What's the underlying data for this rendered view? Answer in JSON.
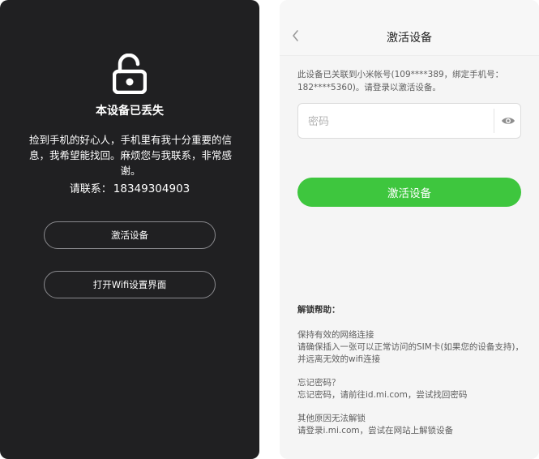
{
  "left": {
    "title": "本设备已丢失",
    "message": "捡到手机的好心人，手机里有我十分重要的信息，我希望能找回。麻烦您与我联系，非常感谢。",
    "contact_label": "请联系：",
    "contact_phone": "18349304903",
    "activate_label": "激活设备",
    "wifi_label": "打开Wifi设置界面"
  },
  "right": {
    "title": "激活设备",
    "device_info": "此设备已关联到小米帐号(109****389，绑定手机号：182****5360)。请登录以激活设备。",
    "password_placeholder": "密码",
    "activate_label": "激活设备",
    "help": {
      "title": "解锁帮助：",
      "sections": [
        {
          "heading": "保持有效的网络连接",
          "body": "请确保插入一张可以正常访问的SIM卡(如果您的设备支持)，并远离无效的wifi连接"
        },
        {
          "heading": "忘记密码？",
          "body": "忘记密码，请前往id.mi.com，尝试找回密码"
        },
        {
          "heading": "其他原因无法解锁",
          "body": "请登录i.mi.com，尝试在网站上解锁设备"
        }
      ]
    }
  },
  "colors": {
    "left_background": "#202022",
    "accent_green": "#3ec63e",
    "right_background": "#f5f5f5"
  },
  "icons": {
    "lock": "unlocked-padlock-icon",
    "back": "chevron-left-icon",
    "eye": "eye-icon"
  }
}
